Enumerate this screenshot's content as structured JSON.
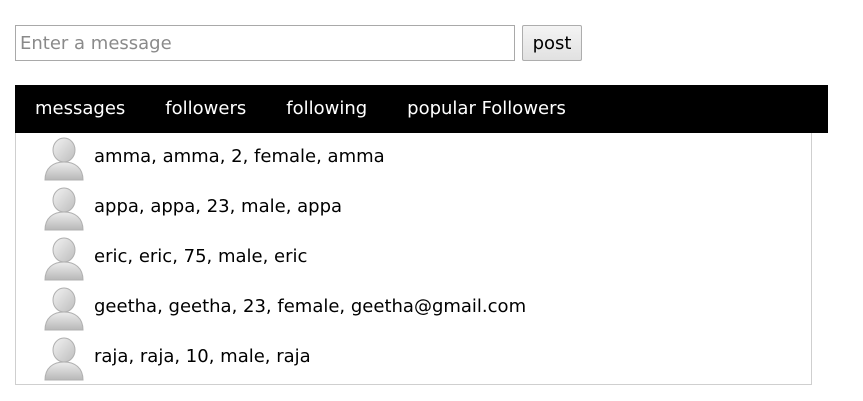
{
  "composer": {
    "placeholder": "Enter a message",
    "value": "",
    "post_label": "post"
  },
  "nav": {
    "tabs": [
      {
        "label": "messages"
      },
      {
        "label": "followers"
      },
      {
        "label": "following"
      },
      {
        "label": "popular Followers"
      }
    ]
  },
  "users": [
    {
      "text": "amma, amma, 2, female, amma",
      "avatar": "user-avatar-icon"
    },
    {
      "text": "appa, appa, 23, male, appa",
      "avatar": "user-avatar-icon"
    },
    {
      "text": "eric, eric, 75, male, eric",
      "avatar": "user-avatar-icon"
    },
    {
      "text": "geetha, geetha, 23, female, geetha@gmail.com",
      "avatar": "user-avatar-icon"
    },
    {
      "text": "raja, raja, 10, male, raja",
      "avatar": "user-avatar-icon"
    }
  ],
  "colors": {
    "nav_background": "#000000",
    "nav_text": "#ffffff",
    "list_border": "#cfcfcf"
  }
}
